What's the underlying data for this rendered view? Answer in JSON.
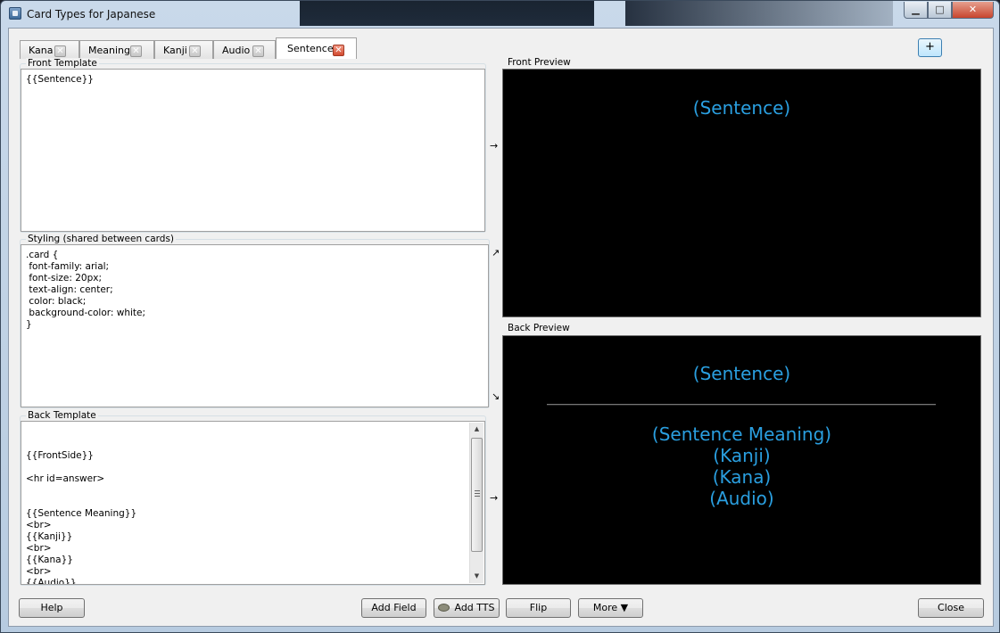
{
  "window": {
    "title": "Card Types for Japanese",
    "controls": {
      "minimize": "▁",
      "maximize": "□",
      "close": "✕"
    }
  },
  "tabs": [
    {
      "label": "Kana",
      "active": false
    },
    {
      "label": "Meaning",
      "active": false
    },
    {
      "label": "Kanji",
      "active": false
    },
    {
      "label": "Audio",
      "active": false
    },
    {
      "label": "Sentence",
      "active": true
    }
  ],
  "tab_close_glyph": "✕",
  "add_card_type_label": "+",
  "front_template": {
    "label": "Front Template",
    "content": "{{Sentence}}"
  },
  "styling": {
    "label": "Styling (shared between cards)",
    "content": ".card {\n font-family: arial;\n font-size: 20px;\n text-align: center;\n color: black;\n background-color: white;\n}"
  },
  "back_template": {
    "label": "Back Template",
    "content": "{{FrontSide}}\n\n<hr id=answer>\n\n\n{{Sentence Meaning}}\n<br>\n{{Kanji}}\n<br>\n{{Kana}}\n<br>\n{{Audio}}"
  },
  "front_preview": {
    "label": "Front Preview",
    "lines": [
      "(Sentence)"
    ]
  },
  "back_preview": {
    "label": "Back Preview",
    "question": "(Sentence)",
    "answer_lines": [
      "(Sentence Meaning)",
      "(Kanji)",
      "(Kana)",
      "(Audio)"
    ]
  },
  "arrows": {
    "front": "→",
    "styling_up": "↗",
    "styling_down": "↘",
    "back": "→"
  },
  "buttons": {
    "help": "Help",
    "add_field": "Add Field",
    "add_tts": "Add TTS",
    "flip": "Flip",
    "more": "More ▼",
    "close": "Close"
  },
  "colors": {
    "preview_text": "#2a9fe0",
    "preview_background": "#000000",
    "active_tab_close": "#d24a2f"
  }
}
